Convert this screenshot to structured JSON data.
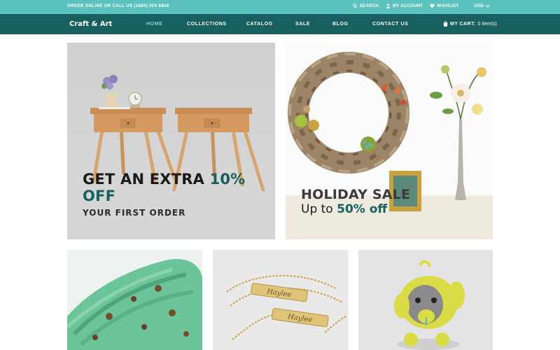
{
  "topbar": {
    "contact": "ORDER ONLINE OR CALL US (1800) 000 8808",
    "search": "SEARCH",
    "account": "MY ACCOUNT",
    "wishlist": "WISHLIST",
    "currency": "USD",
    "icons": {
      "search": "search-icon",
      "account": "user-icon",
      "wishlist": "heart-icon",
      "currency": "chevron-down-icon"
    }
  },
  "nav": {
    "logo": "Craft & Art",
    "items": [
      {
        "label": "HOME",
        "active": true
      },
      {
        "label": "COLLECTIONS",
        "active": false
      },
      {
        "label": "CATALOG",
        "active": false
      },
      {
        "label": "SALE",
        "active": false
      },
      {
        "label": "BLOG",
        "active": false
      },
      {
        "label": "CONTACT US",
        "active": false
      }
    ],
    "cart_label": "MY CART:",
    "cart_count": "0 item(s)",
    "cart_icon": "shopping-bag-icon"
  },
  "banners": {
    "left": {
      "line1": "GET AN EXTRA ",
      "percent": "10%",
      "line2": "OFF",
      "subtitle": "YOUR FIRST ORDER"
    },
    "right": {
      "title": "HOLIDAY SALE",
      "sub_prefix": "Up to ",
      "sub_accent": "50% off"
    }
  },
  "colors": {
    "topbar": "#5cc2bd",
    "nav": "#17605f",
    "accent": "#17605f",
    "active_nav": "#7fd6cf"
  }
}
